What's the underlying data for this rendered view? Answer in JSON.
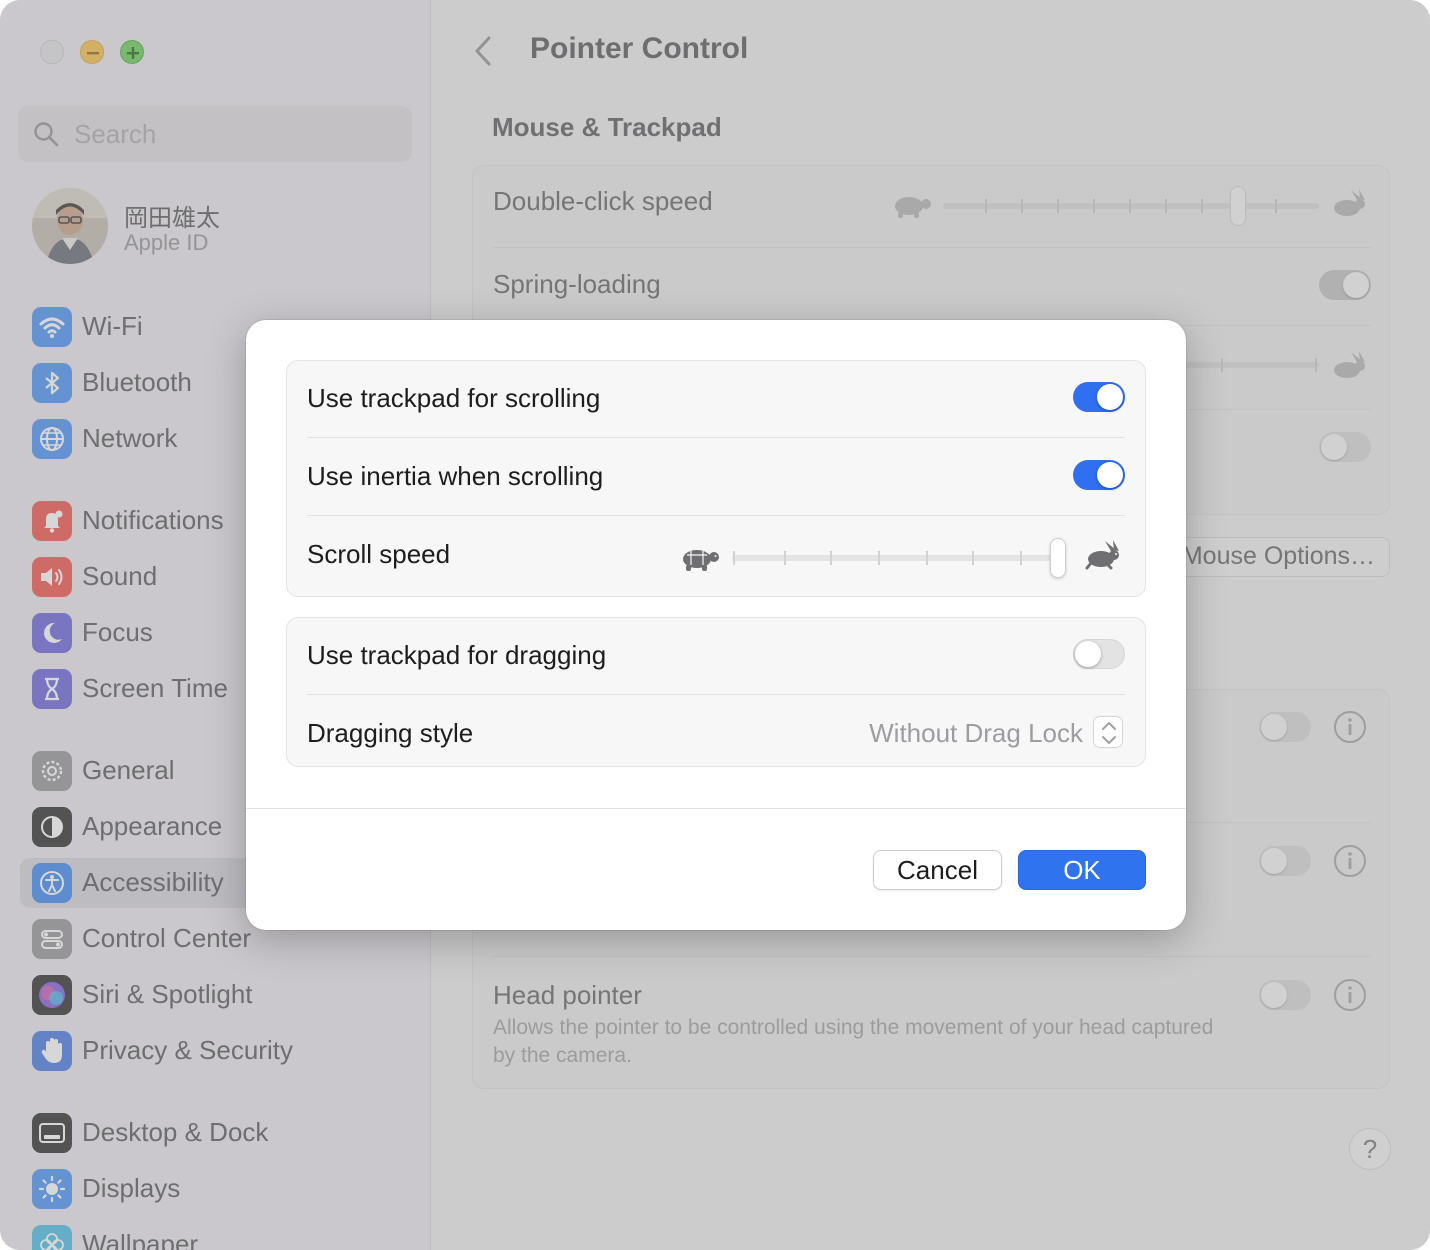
{
  "window": {
    "title": "Pointer Control"
  },
  "sidebar": {
    "search_placeholder": "Search",
    "profile": {
      "name": "岡田雄太",
      "subtitle": "Apple ID"
    },
    "items": [
      {
        "label": "Wi-Fi",
        "icon": "wifi-icon",
        "color": "#3b8bf6"
      },
      {
        "label": "Bluetooth",
        "icon": "bluetooth-icon",
        "color": "#3b8bf6"
      },
      {
        "label": "Network",
        "icon": "globe-icon",
        "color": "#3b8bf6"
      },
      {
        "label": "Notifications",
        "icon": "bell-icon",
        "color": "#f2453d"
      },
      {
        "label": "Sound",
        "icon": "speaker-icon",
        "color": "#f2453d"
      },
      {
        "label": "Focus",
        "icon": "moon-icon",
        "color": "#5f57d9"
      },
      {
        "label": "Screen Time",
        "icon": "hourglass-icon",
        "color": "#5f57d9"
      },
      {
        "label": "General",
        "icon": "gear-icon",
        "color": "#8e8e93"
      },
      {
        "label": "Appearance",
        "icon": "appearance-icon",
        "color": "#1c1c1e"
      },
      {
        "label": "Accessibility",
        "icon": "accessibility-icon",
        "color": "#2f80f2"
      },
      {
        "label": "Control Center",
        "icon": "control-center-icon",
        "color": "#8e8e93"
      },
      {
        "label": "Siri & Spotlight",
        "icon": "siri-icon",
        "color": "#b04ad8"
      },
      {
        "label": "Privacy & Security",
        "icon": "hand-icon",
        "color": "#3a6fe0"
      },
      {
        "label": "Desktop & Dock",
        "icon": "dock-icon",
        "color": "#1c1c1e"
      },
      {
        "label": "Displays",
        "icon": "sun-icon",
        "color": "#3b8bf6"
      },
      {
        "label": "Wallpaper",
        "icon": "flower-icon",
        "color": "#39b8e6"
      }
    ],
    "active_item": "Accessibility"
  },
  "main": {
    "section_title": "Mouse & Trackpad",
    "double_click_label": "Double-click speed",
    "double_click_value": 0.7,
    "spring_loading_label": "Spring-loading",
    "spring_loading_on": true,
    "mouse_options_label": "Mouse Options…",
    "head_pointer_label": "Head pointer",
    "head_pointer_desc": "Allows the pointer to be controlled using the movement of your head captured by the camera.",
    "help_label": "?"
  },
  "sheet": {
    "scrolling_label": "Use trackpad for scrolling",
    "scrolling_on": true,
    "inertia_label": "Use inertia when scrolling",
    "inertia_on": true,
    "scroll_speed_label": "Scroll speed",
    "scroll_speed_value": 1.0,
    "dragging_label": "Use trackpad for dragging",
    "dragging_on": false,
    "dragging_style_label": "Dragging style",
    "dragging_style_value": "Without Drag Lock",
    "cancel_label": "Cancel",
    "ok_label": "OK",
    "accent_color": "#2f6ff0"
  }
}
